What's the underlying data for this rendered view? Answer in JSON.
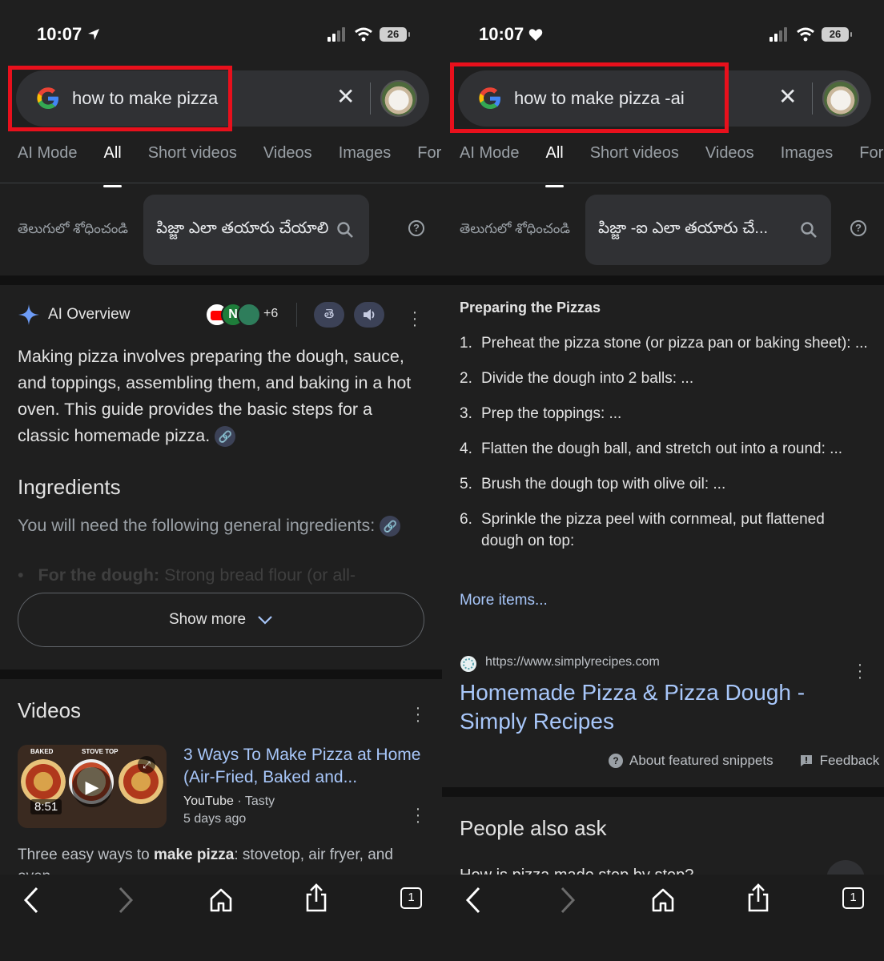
{
  "left": {
    "status": {
      "time": "10:07",
      "battery": "26"
    },
    "search": {
      "query": "how to make pizza"
    },
    "tabs": [
      "AI Mode",
      "All",
      "Short videos",
      "Videos",
      "Images",
      "For"
    ],
    "translate": {
      "label": "తెలుగులో శోధించండి",
      "query": "పిజ్జా ఎలా తయారు చేయాలి"
    },
    "ai_overview": {
      "title": "AI Overview",
      "source_count": "+6",
      "lang_chip": "తె",
      "summary": "Making pizza involves preparing the dough, sauce, and toppings, assembling them, and baking in a hot oven. This guide provides the basic steps for a classic homemade pizza.",
      "ingredients_heading": "Ingredients",
      "ingredients_intro": "You will need the following general ingredients:",
      "faded_item_bold": "For the dough:",
      "faded_item_text": " Strong bread flour (or all-",
      "show_more": "Show more"
    },
    "videos": {
      "heading": "Videos",
      "item": {
        "title": "3 Ways To Make Pizza at Home (Air-Fried, Baked and...",
        "source": "YouTube",
        "channel": "Tasty",
        "age": "5 days ago",
        "duration": "8:51",
        "thumb_labels": [
          "BAKED",
          "STOVE TOP"
        ],
        "snippet_pre": "Three easy ways to ",
        "snippet_bold": "make pizza",
        "snippet_post": ": stovetop, air fryer, and oven..."
      }
    },
    "navbar": {
      "tab_count": "1"
    }
  },
  "right": {
    "status": {
      "time": "10:07",
      "battery": "26"
    },
    "search": {
      "query": "how to make pizza -ai"
    },
    "tabs": [
      "AI Mode",
      "All",
      "Short videos",
      "Videos",
      "Images",
      "For"
    ],
    "translate": {
      "label": "తెలుగులో శోధించండి",
      "query": "పిజ్జా -ఐ ఎలా తయారు చే..."
    },
    "snippet": {
      "heading": "Preparing the Pizzas",
      "steps": [
        {
          "n": "1.",
          "text": "Preheat the pizza stone (or pizza pan or baking sheet): ..."
        },
        {
          "n": "2.",
          "text": "Divide the dough into 2 balls: ..."
        },
        {
          "n": "3.",
          "text": "Prep the toppings: ..."
        },
        {
          "n": "4.",
          "text": "Flatten the dough ball, and stretch out into a round: ..."
        },
        {
          "n": "5.",
          "text": "Brush the dough top with olive oil: ..."
        },
        {
          "n": "6.",
          "text": "Sprinkle the pizza peel with cornmeal, put flattened dough on top:"
        }
      ],
      "more_items": "More items...",
      "source_url": "https://www.simplyrecipes.com",
      "result_title": "Homemade Pizza & Pizza Dough - Simply Recipes",
      "about_snippets": "About featured snippets",
      "feedback": "Feedback"
    },
    "people_also_ask": {
      "heading": "People also ask",
      "partial_question": "How is pizza made step by step?"
    },
    "navbar": {
      "tab_count": "1"
    }
  },
  "colors": {
    "annotation_box": "#e8101c",
    "link": "#a8c7fa",
    "background": "#1f1f1f"
  }
}
